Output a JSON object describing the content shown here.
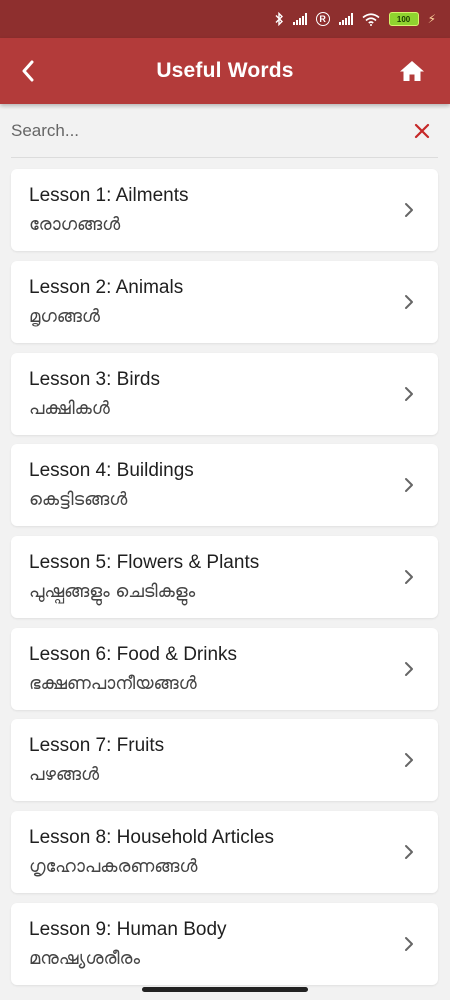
{
  "status_bar": {
    "battery": "100",
    "icons": [
      "bluetooth-icon",
      "signal-icon",
      "roaming-icon",
      "signal-icon",
      "wifi-icon",
      "battery-icon",
      "charging-icon"
    ]
  },
  "header": {
    "title": "Useful Words",
    "back_icon": "back-arrow-icon",
    "home_icon": "home-icon",
    "accent_color": "#b33b3a"
  },
  "search": {
    "placeholder": "Search...",
    "value": "",
    "clear_icon": "close-icon",
    "clear_color": "#c62828"
  },
  "lessons": [
    {
      "title": "Lesson 1: Ailments",
      "subtitle": "രോഗങ്ങൾ"
    },
    {
      "title": "Lesson 2: Animals",
      "subtitle": "മൃഗങ്ങൾ"
    },
    {
      "title": "Lesson 3: Birds",
      "subtitle": "പക്ഷികൾ"
    },
    {
      "title": "Lesson 4: Buildings",
      "subtitle": "കെട്ടിടങ്ങൾ"
    },
    {
      "title": "Lesson 5: Flowers & Plants",
      "subtitle": "പുഷ്പങ്ങളും ചെടികളും"
    },
    {
      "title": "Lesson 6: Food & Drinks",
      "subtitle": "ഭക്ഷണപാനീയങ്ങൾ"
    },
    {
      "title": "Lesson 7: Fruits",
      "subtitle": "പഴങ്ങൾ"
    },
    {
      "title": "Lesson 8: Household Articles",
      "subtitle": "ഗൃഹോപകരണങ്ങൾ"
    },
    {
      "title": "Lesson 9: Human Body",
      "subtitle": "മനുഷ്യശരീരം"
    }
  ]
}
